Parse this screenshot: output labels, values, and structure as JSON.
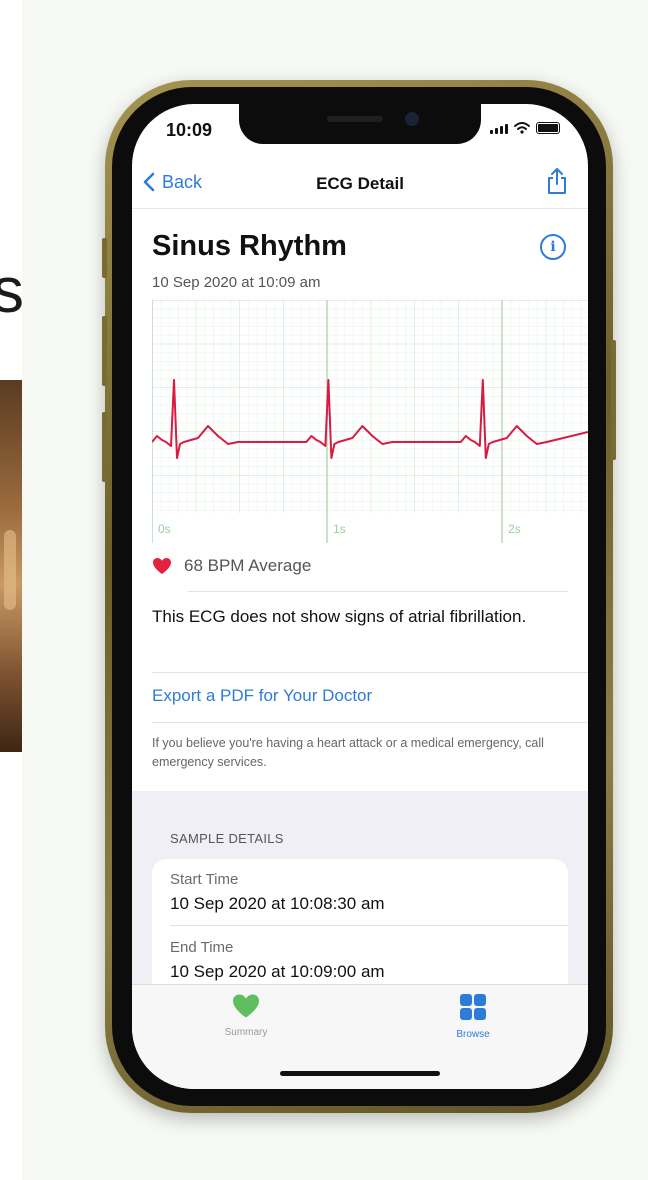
{
  "background": {
    "left_letter": "s"
  },
  "status_bar": {
    "time": "10:09"
  },
  "nav": {
    "back_label": "Back",
    "title": "ECG Detail"
  },
  "ecg": {
    "result_title": "Sinus Rhythm",
    "datetime": "10 Sep 2020 at 10:09 am",
    "time_labels": [
      "0s",
      "1s",
      "2s"
    ],
    "bpm_text": "68 BPM Average",
    "statement": "This ECG does not show signs of atrial fibrillation.",
    "export_link": "Export a PDF for Your Doctor",
    "disclaimer": "If you believe you're having a heart attack or a medical emergency, call emergency services."
  },
  "sample_details": {
    "header": "SAMPLE DETAILS",
    "start_label": "Start Time",
    "start_value": "10 Sep 2020 at 10:08:30 am",
    "end_label": "End Time",
    "end_value": "10 Sep 2020 at 10:09:00 am"
  },
  "tabbar": {
    "summary_label": "Summary",
    "browse_label": "Browse"
  },
  "icons": {
    "back": "chevron-left-icon",
    "share": "share-icon",
    "info": "info-icon",
    "heart": "heart-icon",
    "summary": "heart-icon",
    "browse": "grid-icon"
  },
  "colors": {
    "accent": "#2f7bd8",
    "heart": "#e5213f",
    "ecg_trace": "#d81b43",
    "ecg_grid": "#cde5cc",
    "summary_tab": "#5fbf60",
    "browse_tab": "#2f7bd8"
  }
}
